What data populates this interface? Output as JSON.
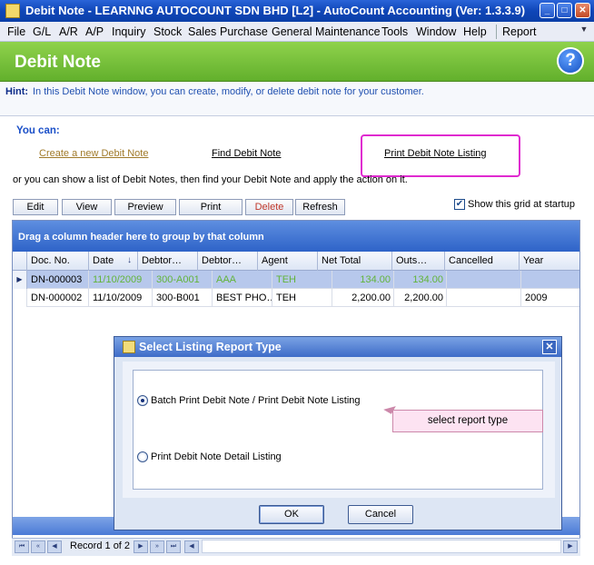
{
  "window": {
    "title": "Debit Note - LEARNNG AUTOCOUNT SDN BHD [L2] - AutoCount Accounting (Ver: 1.3.3.9)",
    "min": "_",
    "max": "□",
    "close": "✕"
  },
  "menu": [
    "File",
    "G/L",
    "A/R",
    "A/P",
    "Inquiry",
    "Stock",
    "Sales",
    "Purchase",
    "General Maintenance",
    "Tools",
    "Window",
    "Help",
    "Report"
  ],
  "header": {
    "title": "Debit Note",
    "help_glyph": "?"
  },
  "hint": {
    "label": "Hint:",
    "text": "In this Debit Note window, you can create, modify, or delete debit note for your customer."
  },
  "main": {
    "you_can": "You can:",
    "links": {
      "create": "Create a new Debit Note",
      "find": "Find Debit Note",
      "print": "Print Debit Note Listing"
    },
    "or_text": "or you can show a list of Debit Notes, then find your Debit Note and apply the action on it.",
    "toolbar": {
      "edit": "Edit",
      "view": "View",
      "preview": "Preview",
      "print": "Print",
      "delete": "Delete",
      "refresh": "Refresh"
    },
    "show_grid_startup": "Show this grid at startup",
    "show_grid_checked": "✔"
  },
  "grid": {
    "group_hint": "Drag a column header here to group by that column",
    "columns": [
      "Doc. No.",
      "Date",
      "Debtor…",
      "Debtor…",
      "Agent",
      "Net Total",
      "Outs…",
      "Cancelled",
      "Year"
    ],
    "sort_glyph": "↓",
    "rows": [
      [
        "DN-000003",
        "11/10/2009",
        "300-A001",
        "AAA",
        "TEH",
        "134.00",
        "134.00",
        "",
        ""
      ],
      [
        "DN-000002",
        "11/10/2009",
        "300-B001",
        "BEST PHO…",
        "TEH",
        "2,200.00",
        "2,200.00",
        "",
        "2009"
      ]
    ],
    "row_indicator": "▶",
    "nav": {
      "record": "Record 1 of 2",
      "first": "⏮",
      "prev_page": "«",
      "prev": "◀",
      "next": "▶",
      "next_page": "»",
      "last": "⏭",
      "scroll_left": "◀",
      "scroll_right": "▶"
    }
  },
  "dialog": {
    "title": "Select Listing Report Type",
    "close": "✕",
    "option1": "Batch Print Debit Note / Print Debit Note Listing",
    "option2": "Print Debit Note Detail Listing",
    "tooltip": "select report type",
    "ok": "OK",
    "cancel": "Cancel"
  }
}
